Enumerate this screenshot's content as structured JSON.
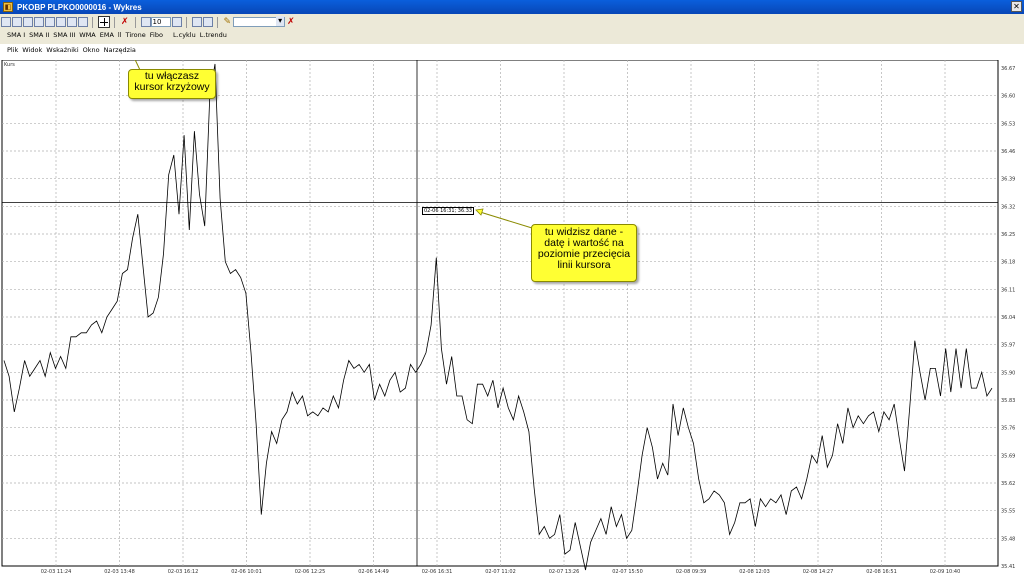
{
  "window": {
    "title": "PKOBP PLPKO0000016 - Wykres",
    "app_icon": "chart-app-icon",
    "controls": [
      "_",
      "□",
      "✕"
    ]
  },
  "toolbar": {
    "period_value": "10",
    "indicators": [
      "SMA I",
      "SMA II",
      "SMA III",
      "WMA",
      "EMA",
      "ll",
      "Tirone",
      "Fibo",
      "L.cyklu",
      "L.trendu"
    ]
  },
  "menu": {
    "items": [
      "Plik",
      "Widok",
      "Wskaźniki",
      "Okno",
      "Narzędzia"
    ]
  },
  "chart": {
    "corner_label": "Kurs",
    "readout": "02-06 16:31; 36.33"
  },
  "chart_data": {
    "type": "line",
    "ylim": [
      35.41,
      36.67
    ],
    "y_ticks": [
      "36.67",
      "36.60",
      "36.53",
      "36.46",
      "36.39",
      "36.32",
      "36.25",
      "36.18",
      "36.11",
      "36.04",
      "35.97",
      "35.90",
      "35.83",
      "35.76",
      "35.69",
      "35.62",
      "35.55",
      "35.48",
      "35.41"
    ],
    "x_ticks": [
      "02-03 11:24",
      "02-03 13:48",
      "02-03 16:12",
      "02-06 10:01",
      "02-06 12:25",
      "02-06 14:49",
      "02-06 16:31",
      "02-07 11:02",
      "02-07 13:26",
      "02-07 15:50",
      "02-08 09:39",
      "02-08 12:03",
      "02-08 14:27",
      "02-08 16:51",
      "02-09 10:40"
    ],
    "crosshair": {
      "date": "02-06 16:31",
      "value": 36.33
    },
    "series": [
      {
        "values": [
          35.93,
          35.89,
          35.8,
          35.86,
          35.93,
          35.89,
          35.91,
          35.93,
          35.89,
          35.95,
          35.91,
          35.94,
          35.91,
          35.99,
          35.99,
          36.0,
          36.0,
          36.02,
          36.03,
          36.0,
          36.04,
          36.06,
          36.08,
          36.15,
          36.16,
          36.24,
          36.3,
          36.17,
          36.04,
          36.05,
          36.09,
          36.2,
          36.4,
          36.45,
          36.3,
          36.5,
          36.26,
          36.51,
          36.35,
          36.27,
          36.6,
          36.68,
          36.34,
          36.18,
          36.15,
          36.16,
          36.14,
          36.1,
          35.95,
          35.77,
          35.54,
          35.67,
          35.75,
          35.72,
          35.78,
          35.8,
          35.85,
          35.82,
          35.84,
          35.79,
          35.8,
          35.79,
          35.81,
          35.8,
          35.84,
          35.81,
          35.88,
          35.93,
          35.91,
          35.92,
          35.9,
          35.92,
          35.83,
          35.87,
          35.84,
          35.88,
          35.9,
          35.85,
          35.86,
          35.92,
          35.9,
          35.92,
          35.95,
          36.02,
          36.19,
          35.96,
          35.87,
          35.94,
          35.84,
          35.84,
          35.78,
          35.77,
          35.87,
          35.87,
          35.84,
          35.88,
          35.81,
          35.86,
          35.81,
          35.78,
          35.84,
          35.8,
          35.75,
          35.61,
          35.49,
          35.51,
          35.48,
          35.49,
          35.54,
          35.44,
          35.45,
          35.52,
          35.46,
          35.4,
          35.47,
          35.5,
          35.53,
          35.49,
          35.56,
          35.51,
          35.54,
          35.48,
          35.5,
          35.59,
          35.69,
          35.76,
          35.71,
          35.63,
          35.67,
          35.64,
          35.82,
          35.74,
          35.81,
          35.76,
          35.72,
          35.63,
          35.57,
          35.58,
          35.6,
          35.59,
          35.57,
          35.49,
          35.52,
          35.57,
          35.57,
          35.58,
          35.51,
          35.58,
          35.56,
          35.58,
          35.57,
          35.59,
          35.54,
          35.6,
          35.61,
          35.58,
          35.63,
          35.69,
          35.67,
          35.74,
          35.66,
          35.69,
          35.77,
          35.72,
          35.81,
          35.76,
          35.79,
          35.77,
          35.79,
          35.8,
          35.75,
          35.8,
          35.78,
          35.82,
          35.73,
          35.65,
          35.81,
          35.98,
          35.9,
          35.83,
          35.91,
          35.91,
          35.84,
          35.96,
          35.85,
          35.96,
          35.86,
          35.96,
          35.86,
          35.86,
          35.9,
          35.84,
          35.86
        ]
      }
    ]
  }
}
